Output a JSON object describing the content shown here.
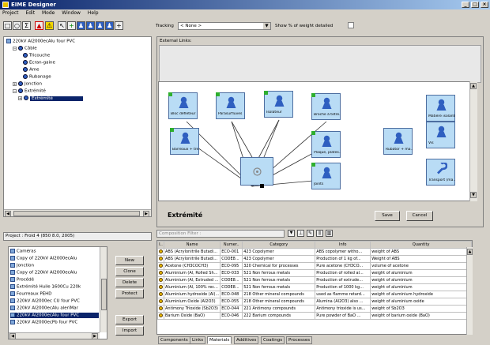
{
  "window": {
    "title": "EIME Designer",
    "min": "_",
    "max": "□",
    "close": "×"
  },
  "menu": [
    "Project",
    "Edit",
    "Mode",
    "Window",
    "Help"
  ],
  "toolbar": {
    "tracking_label": "Tracking",
    "tracking_value": "< None >",
    "show_weight_label": "Show % of weight detailed"
  },
  "tree": {
    "root": "220kV Al2000ecAlu four PVC",
    "items": [
      "Câble",
      "Tricouche",
      "Ecran-gaine",
      "Ame",
      "Rubanage",
      "Jonction",
      "Extrémité",
      "Extrémité"
    ]
  },
  "canvas": {
    "external_links_label": "External Links:",
    "nodes": [
      {
        "label": "Bloc défleteur"
      },
      {
        "label": "Parasurfluves"
      },
      {
        "label": "Isolateur"
      },
      {
        "label": "Broche à tetre..."
      },
      {
        "label": "Matière isolante"
      },
      {
        "label": "Barreaux + tre..."
      },
      {
        "label": "Plaque, plates..."
      },
      {
        "label": "Rubator + ma..."
      },
      {
        "label": "Vis"
      },
      {
        "label": "Joints"
      },
      {
        "label": "Transport (ma..."
      },
      {
        "label": ""
      }
    ],
    "title": "Extrémité",
    "save_label": "Save",
    "cancel_label": "Cancel"
  },
  "project": {
    "label": "Project : Froid 4 (850 8.0, 2005)",
    "items": [
      "Caméras",
      "Copy of 220kV Al2000ecAlu",
      "Jonction",
      "Copy of 220kV Al2000ecAlu",
      "Procédé",
      "Extrémité Huile 1600Cu 220k",
      "Fourreaux PEHD",
      "220kV Al2000ec CU four PVC",
      "220kV Al2000ecAlu aleriMar",
      "220kV Al2000ecAlu four PVC",
      "220kV Al2000ecPb four PVC"
    ],
    "buttons": [
      "New",
      "Clone",
      "Delete",
      "Protect",
      "Export",
      "Import"
    ]
  },
  "materials": {
    "filter_placeholder": "Composition Filter :",
    "columns": [
      "I..",
      "Name",
      "Numer..",
      "Category",
      "Info",
      "Quantity"
    ],
    "rows": [
      [
        "ABS (Acrylonitrile Butadi...",
        "ECO-001",
        "423 Copolymer",
        "ABS copolymer witho...",
        "weight of ABS"
      ],
      [
        "ABS (Acrylonitrile Butadi...",
        "CODE8...",
        "423 Copolymer",
        "Production of 1 kg of...",
        "Weight of ABS"
      ],
      [
        "Acetone (CH3COCH3)",
        "ECO-095",
        "320 Chemical for processes",
        "Pure acetone (CH3CO...",
        "volume of acetone"
      ],
      [
        "Aluminium (Al, Rolled Sh...",
        "ECO-033",
        "521 Non ferrous metals",
        "Production of rolled al...",
        "weight of aluminium"
      ],
      [
        "Aluminium (Al, Extruded ...",
        "CODE8...",
        "521 Non ferrous metals",
        "Production of extrude...",
        "weight of aluminium"
      ],
      [
        "Aluminium (Al, 100% rec...",
        "CODE8...",
        "521 Non ferrous metals",
        "Production of 1000 kg...",
        "weight of aluminium"
      ],
      [
        "Aluminium hydroxide (Al(...",
        "ECO-048",
        "218 Other mineral compounds",
        "used as flamme retard...",
        "weight of aluminium hydroxide"
      ],
      [
        "Aluminium Oxide (Al2O3)",
        "ECO-055",
        "218 Other mineral compounds",
        "Alumina (Al2O3) also ...",
        "weight of aluminium oxide"
      ],
      [
        "Antimony Trioxide (Sb2O3)",
        "ECO-044",
        "221 Antimony compounds",
        "Antimony trioxide is us...",
        "weight of Sb2O3"
      ],
      [
        "Barium Oxide (BaO)",
        "ECO-046",
        "222 Barium compounds",
        "Pure powder of BaO ...",
        "weight of barium oxide (BaO)"
      ]
    ]
  },
  "tabs": [
    "Components",
    "Links",
    "Materials",
    "Additives",
    "Coatings",
    "Processes"
  ]
}
